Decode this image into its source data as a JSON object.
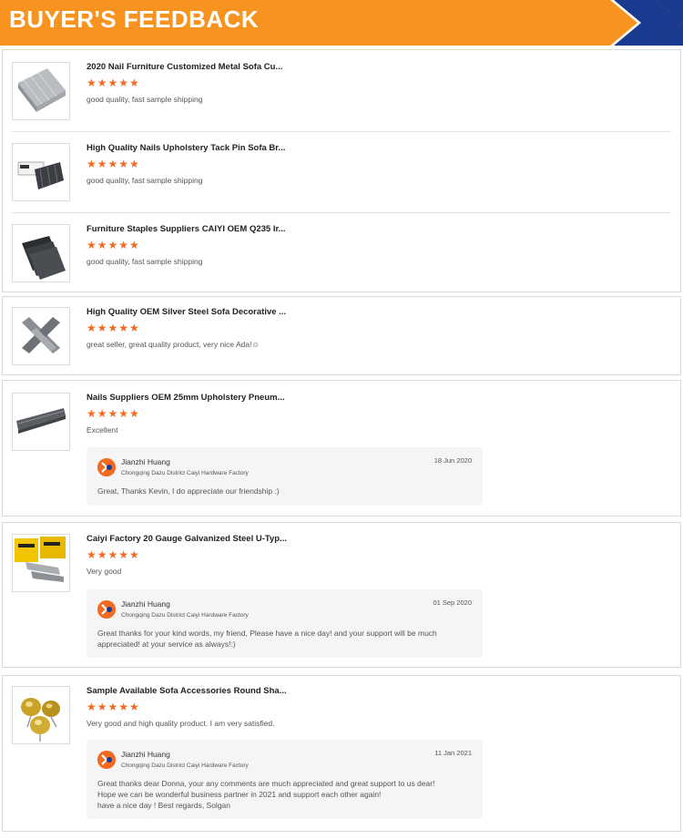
{
  "header": {
    "title": "BUYER'S FEEDBACK"
  },
  "colors": {
    "accent_orange": "#f7931e",
    "star_orange": "#f36a21",
    "arrow_blue": "#1a3a8f"
  },
  "reviews": [
    {
      "title": "2020 Nail Furniture Customized Metal Sofa Cu...",
      "stars": "★★★★★",
      "comment": "good quality, fast sample shipping",
      "thumb_icon": "silver-staples-thumbnail"
    },
    {
      "title": "High Quality Nails Upholstery Tack Pin Sofa Br...",
      "stars": "★★★★★",
      "comment": "good quality, fast sample shipping",
      "thumb_icon": "boxed-staples-thumbnail"
    },
    {
      "title": "Furniture Staples Suppliers CAIYI OEM Q235 Ir...",
      "stars": "★★★★★",
      "comment": "good quality, fast sample shipping",
      "thumb_icon": "black-staples-thumbnail"
    },
    {
      "title": "High Quality OEM Silver Steel Sofa Decorative ...",
      "stars": "★★★★★",
      "comment": "great seller, great quality product, very nice Ada!☺",
      "thumb_icon": "crossed-staples-thumbnail"
    },
    {
      "title": "Nails Suppliers OEM 25mm Upholstery Pneum...",
      "stars": "★★★★★",
      "comment": "Excellent",
      "thumb_icon": "brad-nails-thumbnail",
      "reply": {
        "name": "Jianzhi Huang",
        "company": "Chongqing Dazu District Caiyi Hardware Factory",
        "date": "18 Jun 2020",
        "lines": [
          "Great, Thanks Kevin, I do appreciate our friendship :)"
        ]
      }
    },
    {
      "title": "Caiyi Factory 20 Gauge Galvanized Steel U-Typ...",
      "stars": "★★★★★",
      "comment": "Very good",
      "thumb_icon": "yellow-box-staples-thumbnail",
      "reply": {
        "name": "Jianzhi Huang",
        "company": "Chongqing Dazu District Caiyi Hardware Factory",
        "date": "01 Sep 2020",
        "lines": [
          "Great thanks for your kind words, my friend, Please have a nice day! and your support will be much",
          "appreciated! at your service as always!:)"
        ]
      }
    },
    {
      "title": "Sample Available Sofa Accessories Round Sha...",
      "stars": "★★★★★",
      "comment": "Very good and high quality product. I am very satisfied.",
      "thumb_icon": "gold-tacks-thumbnail",
      "reply": {
        "name": "Jianzhi Huang",
        "company": "Chongqing Dazu District Caiyi Hardware Factory",
        "date": "11 Jan 2021",
        "lines": [
          "Great thanks dear Donna, your any comments are much appreciated and great support to us dear!",
          "Hope we can be wonderful business partner in 2021 and support each other again!",
          "have a nice day ! Best regards, Solgan"
        ]
      }
    }
  ]
}
